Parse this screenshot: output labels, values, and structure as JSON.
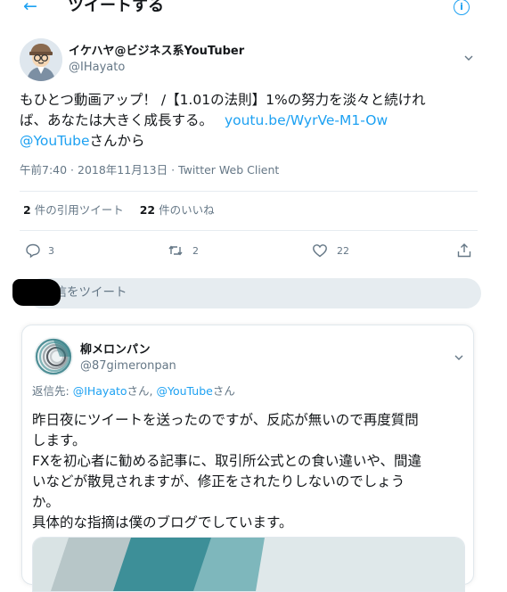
{
  "header": {
    "back_icon": "←",
    "title": "ツイートする",
    "info_icon": "i"
  },
  "tweet": {
    "display_name": "イケハヤ@ビジネス系YouTuber",
    "handle": "@IHayato",
    "text_lines": [
      "もひとつ動画アップ！ /【1.01の法則】1%の努力を淡々と続けれ",
      "ば、あなたは大きく成長する。",
      "youtu.be/WyrVe-M1-Ow",
      "@YouTube",
      "さんから"
    ],
    "meta": "午前7:40 · 2018年11月13日 · Twitter Web Client",
    "stats": {
      "retweet_count": "2",
      "retweet_label": "件の引用ツイート",
      "like_count": "22",
      "like_label": "件のいいね"
    },
    "actions": {
      "reply_count": "3",
      "retweet_count": "2",
      "like_count": "22"
    }
  },
  "reply_box": {
    "placeholder": "返信をツイート"
  },
  "reply": {
    "display_name": "柳メロンパン",
    "handle": "@87gimeronpan",
    "replying_label": "返信先: ",
    "replying_to_1": "@IHayato",
    "replying_sep": "さん, ",
    "replying_to_2": "@YouTube",
    "replying_end": "さん",
    "text_lines": [
      "昨日夜にツイートを送ったのですが、反応が無いので再度質問",
      "します。",
      "FXを初心者に勧める記事に、取引所公式との食い違いや、間違",
      "いなどが散見されますが、修正をされたりしないのでしょう",
      "か。",
      "具体的な指摘は僕のブログでしています。"
    ]
  },
  "colors": {
    "accent": "#1da1f2",
    "muted": "#657786",
    "border": "#e6ecf0"
  }
}
